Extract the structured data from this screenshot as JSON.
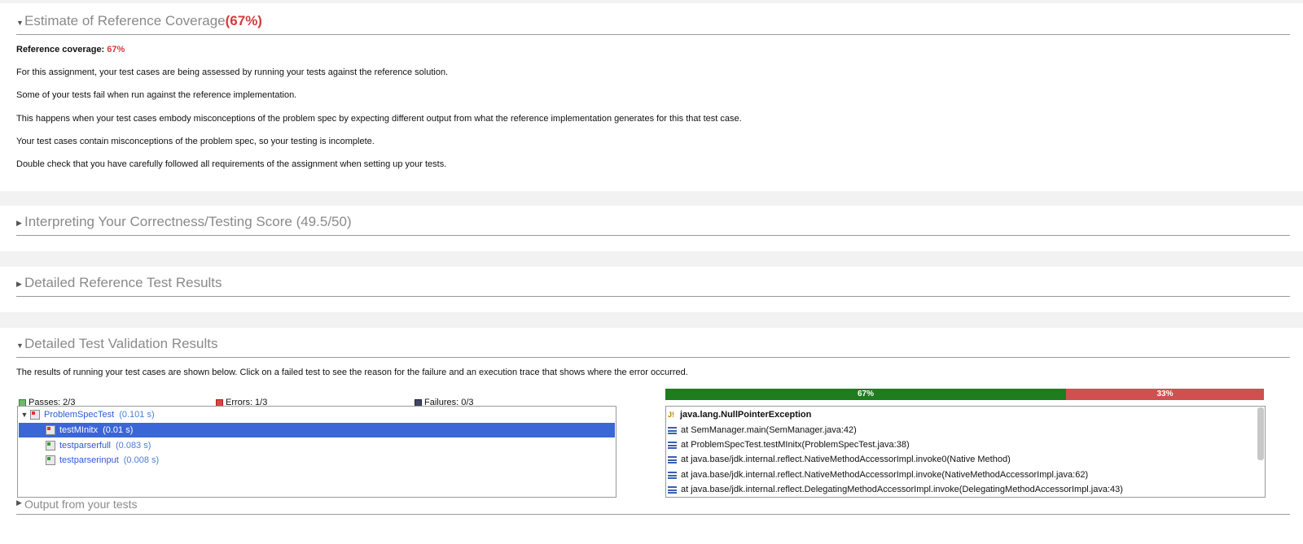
{
  "sections": {
    "coverage": {
      "title": "Estimate of Reference Coverage",
      "pct": "(67%)",
      "expanded": true
    },
    "interpreting": {
      "title": "Interpreting Your Correctness/Testing Score (49.5/50)"
    },
    "ref_results": {
      "title": "Detailed Reference Test Results"
    },
    "validation": {
      "title": "Detailed Test Validation Results"
    },
    "output": {
      "title": "Output from your tests"
    }
  },
  "coverage_body": {
    "label": "Reference coverage:",
    "value": "67%",
    "p1": "For this assignment, your test cases are being assessed by running your tests against the reference solution.",
    "p2": "Some of your tests fail when run against the reference implementation.",
    "p3": "This happens when your test cases embody misconceptions of the problem spec by expecting different output from what the reference implementation generates for this that test case.",
    "p4": "Your test cases contain misconceptions of the problem spec, so your testing is incomplete.",
    "p5": "Double check that you have carefully followed all requirements of the assignment when setting up your tests."
  },
  "validation_body": {
    "intro": "The results of running your test cases are shown below. Click on a failed test to see the reason for the failure and an execution trace that shows where the error occurred.",
    "passes": "Passes: 2/3",
    "errors": "Errors: 1/3",
    "failures": "Failures: 0/3",
    "bar_pass": "67%",
    "bar_fail": "33%",
    "bar_pass_fraction": 0.67,
    "pass_color": "#1e7d1e",
    "fail_color": "#d05050",
    "tree": [
      {
        "name": "ProblemSpecTest",
        "time": "(0.101 s)",
        "level": 0
      },
      {
        "name": "testMInitx",
        "time": "(0.01 s)",
        "level": 1,
        "selected": true
      },
      {
        "name": "testparserfull",
        "time": "(0.083 s)",
        "level": 1
      },
      {
        "name": "testparserinput",
        "time": "(0.008 s)",
        "level": 1
      }
    ],
    "exception": "java.lang.NullPointerException",
    "trace": [
      "at SemManager.main(SemManager.java:42)",
      "at ProblemSpecTest.testMInitx(ProblemSpecTest.java:38)",
      "at java.base/jdk.internal.reflect.NativeMethodAccessorImpl.invoke0(Native Method)",
      "at java.base/jdk.internal.reflect.NativeMethodAccessorImpl.invoke(NativeMethodAccessorImpl.java:62)",
      "at java.base/jdk.internal.reflect.DelegatingMethodAccessorImpl.invoke(DelegatingMethodAccessorImpl.java:43)"
    ]
  }
}
